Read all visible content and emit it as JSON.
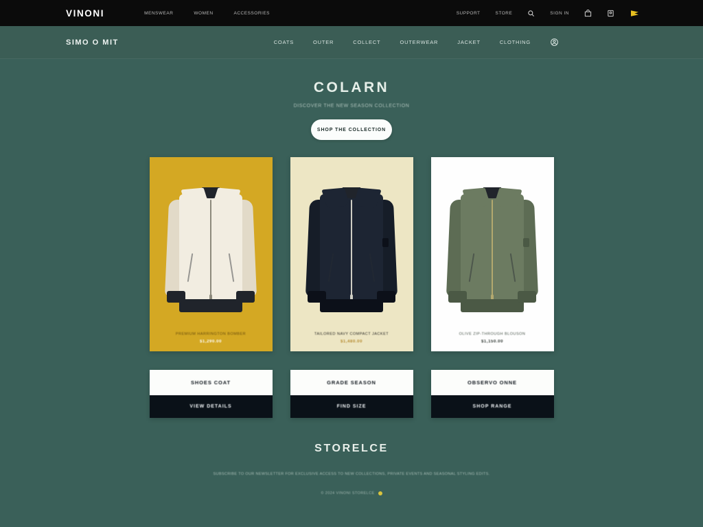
{
  "topbar": {
    "logo": "VINONI",
    "nav": [
      {
        "label": "MENSWEAR"
      },
      {
        "label": "WOMEN"
      },
      {
        "label": "ACCESSORIES"
      }
    ],
    "utility": [
      {
        "label": "SUPPORT"
      },
      {
        "label": "STORE"
      },
      {
        "label": "SIGN IN"
      }
    ],
    "icons": [
      {
        "name": "search-icon"
      },
      {
        "name": "cart-icon"
      },
      {
        "name": "account-icon"
      },
      {
        "name": "flag-icon"
      }
    ]
  },
  "subbar": {
    "store_name": "SIMO O MIT",
    "nav": [
      {
        "label": "COATS"
      },
      {
        "label": "OUTER"
      },
      {
        "label": "COLLECT"
      },
      {
        "label": "OUTERWEAR"
      },
      {
        "label": "JACKET"
      },
      {
        "label": "CLOTHING"
      }
    ],
    "icon": {
      "name": "user-circle-icon"
    }
  },
  "hero": {
    "title": "COLARN",
    "subtitle": "DISCOVER THE NEW SEASON COLLECTION",
    "button_label": "SHOP THE COLLECTION"
  },
  "products": [
    {
      "name": "PREMIUM HARRINGTON BOMBER",
      "price": "$1,290.00",
      "bg_color": "#d4a823",
      "jacket_color": "#f2ede1",
      "jacket_shade": "#e2dac8",
      "trim_color": "#20242b",
      "zip_color": "#8d8a7c",
      "text_color": "#6b4f0c",
      "price_color": "#ffffff",
      "has_badge": false
    },
    {
      "name": "TAILORED NAVY COMPACT JACKET",
      "price": "$1,480.00",
      "bg_color": "#ede6c4",
      "jacket_color": "#1d2533",
      "jacket_shade": "#161d28",
      "trim_color": "#0c1019",
      "zip_color": "#cfcec4",
      "text_color": "#2a2a26",
      "price_color": "#b4892e",
      "has_badge": true
    },
    {
      "name": "OLIVE ZIP-THROUGH BLOUSON",
      "price": "$1,150.00",
      "bg_color": "#fefefe",
      "jacket_color": "#6c7b61",
      "jacket_shade": "#5d6c54",
      "trim_color": "#4b5945",
      "zip_color": "#b3a96f",
      "text_color": "#4e5a50",
      "price_color": "#2c3530",
      "has_badge": true
    }
  ],
  "info_cards": [
    {
      "title": "SHOES COAT",
      "action": "VIEW DETAILS"
    },
    {
      "title": "GRADE SEASON",
      "action": "FIND SIZE"
    },
    {
      "title": "OBSERVO ONNE",
      "action": "SHOP RANGE"
    }
  ],
  "footer": {
    "title": "STORELCE",
    "text": "SUBSCRIBE TO OUR NEWSLETTER FOR EXCLUSIVE ACCESS TO NEW COLLECTIONS, PRIVATE EVENTS AND SEASONAL STYLING EDITS.",
    "copyright": "© 2024 VINONI STORELCE"
  }
}
